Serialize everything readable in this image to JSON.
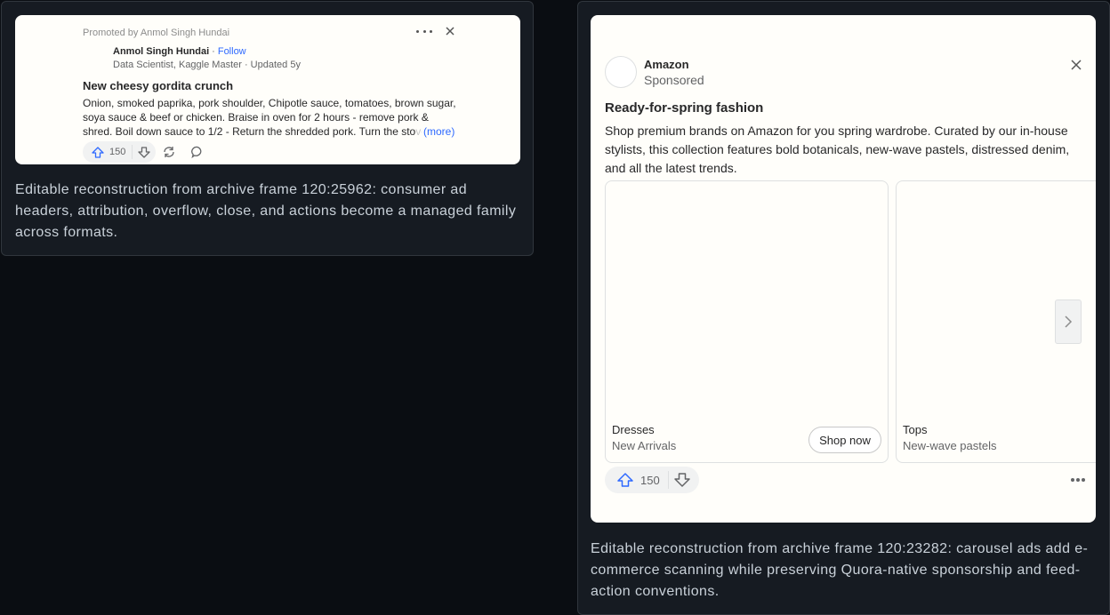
{
  "left_card": {
    "promoted": "Promoted by Anmol Singh Hundai",
    "author": "Anmol Singh Hundai",
    "separator": "·",
    "follow": "Follow",
    "credential": "Data Scientist, Kaggle Master · Updated 5y",
    "title": "New cheesy gordita crunch",
    "body_visible": "Onion, smoked paprika, pork shoulder, Chipotle sauce, tomatoes, brown sugar, soya sauce & beef or chicken. Braise in oven for 2 hours - remove pork & shred. Boil down sauce to 1/2 - Return the shredded pork. Turn the sto",
    "body_faded": "ve",
    "more": "(more)",
    "upvotes": "150",
    "caption": "Editable reconstruction from archive frame 120:25962: consumer ad headers, attribution, overflow, close, and actions become a managed family across formats."
  },
  "right_card": {
    "brand": "Amazon",
    "sponsored": "Sponsored",
    "title": "Ready-for-spring fashion",
    "body": "Shop premium brands on Amazon for you spring wardrobe. Curated by our in-house stylists, this collection features bold botanicals, new-wave pastels, distressed denim, and all the latest trends.",
    "tiles": [
      {
        "name": "Dresses",
        "sub": "New Arrivals",
        "cta": "Shop now"
      },
      {
        "name": "Tops",
        "sub": "New-wave pastels"
      }
    ],
    "upvotes": "150",
    "caption": "Editable reconstruction from archive frame 120:23282: carousel ads add e-commerce scanning while preserving Quora-native sponsorship and feed-action conventions."
  },
  "colors": {
    "accent": "#2e69ff",
    "card_bg": "#fffefa",
    "panel_bg": "#161b22",
    "page_bg": "#0a0d12"
  }
}
